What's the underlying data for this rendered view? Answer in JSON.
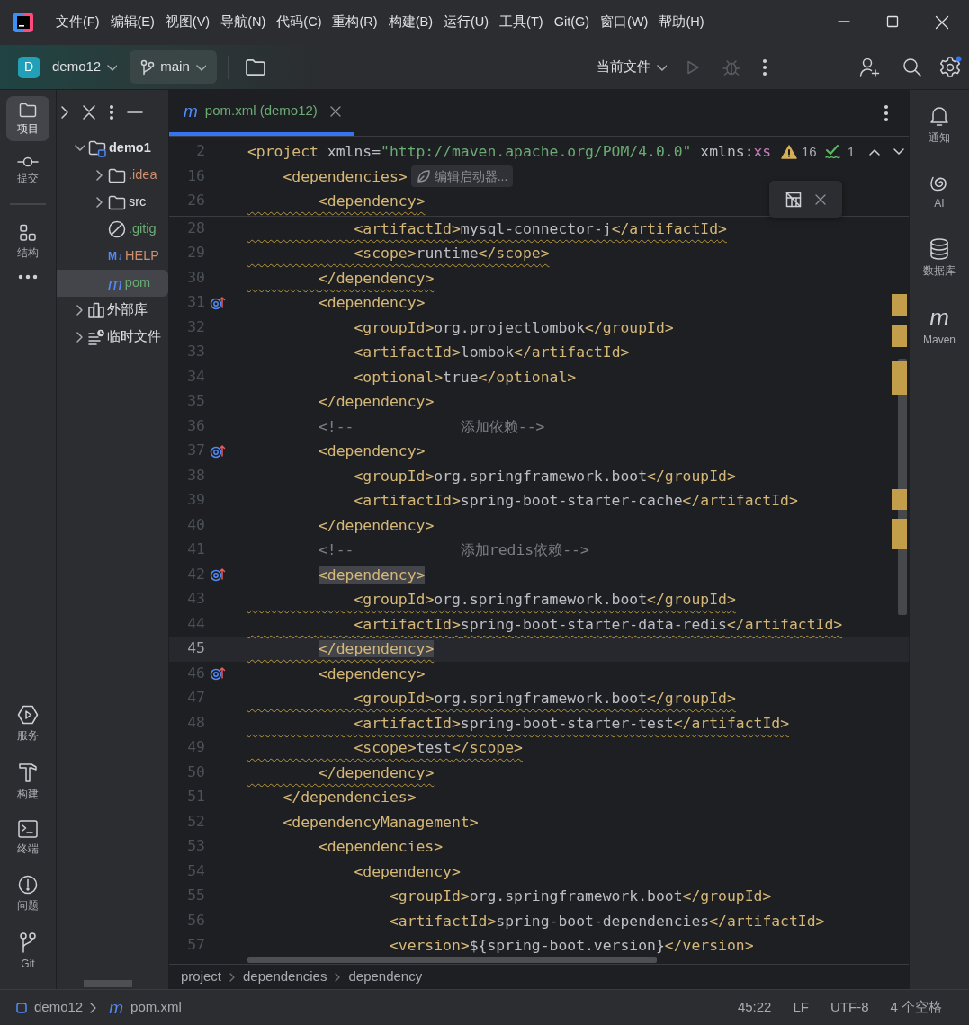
{
  "title_bar": {
    "menu": [
      "文件(F)",
      "编辑(E)",
      "视图(V)",
      "导航(N)",
      "代码(C)",
      "重构(R)",
      "构建(B)",
      "运行(U)",
      "工具(T)",
      "Git(G)",
      "窗口(W)",
      "帮助(H)"
    ]
  },
  "toolbar": {
    "project_badge": "D",
    "project": "demo12",
    "branch": "main",
    "run_config": "当前文件",
    "run_disabled": true,
    "debug_disabled": true,
    "settings_badge": true
  },
  "left_tools": {
    "top": [
      {
        "label": "项目",
        "selected": true
      },
      {
        "label": "提交",
        "selected": false
      },
      {
        "label": "结构",
        "selected": false
      }
    ],
    "bottom": [
      {
        "label": "服务",
        "selected": false
      },
      {
        "label": "构建",
        "selected": false
      },
      {
        "label": "终端",
        "selected": false
      },
      {
        "label": "问题",
        "selected": false
      },
      {
        "label": "Git",
        "selected": false
      }
    ]
  },
  "project_tree": [
    {
      "label": "demo1",
      "kind": "module",
      "expanded": true,
      "selected": false,
      "color": "#dfe1e5",
      "children": [
        {
          "label": ".idea",
          "kind": "folder",
          "expanded": false,
          "selected": false,
          "color": "#cf8e6d"
        },
        {
          "label": "src",
          "kind": "folder",
          "expanded": false,
          "selected": false,
          "color": "#dfe1e5"
        },
        {
          "label": ".gitig",
          "kind": "ignore",
          "selected": false,
          "color": "#6aab73"
        },
        {
          "label": "HELP",
          "kind": "markdown",
          "glyph": "M↓",
          "selected": false,
          "color": "#cf8e6d"
        },
        {
          "label": "pom",
          "kind": "maven",
          "glyph": "m",
          "selected": true,
          "color": "#6aab73"
        }
      ]
    },
    {
      "label": "外部库",
      "kind": "library",
      "expanded": false,
      "selected": false,
      "color": "#dfe1e5"
    },
    {
      "label": "临时文件",
      "kind": "scratch",
      "expanded": false,
      "selected": false,
      "color": "#dfe1e5"
    }
  ],
  "editor": {
    "tabs": [
      {
        "glyph": "m",
        "label": "pom.xml (demo12)",
        "selected": true
      }
    ],
    "problems": {
      "warnings": "16",
      "typos": "1"
    },
    "sticky_lines": [
      {
        "number": "2",
        "kind": "code",
        "text": "<project xmlns=\"http://maven.apache.org/POM/4.0.0\" xmlns:xs",
        "warning": false
      },
      {
        "number": "16",
        "kind": "code",
        "text": "    <dependencies>",
        "warning": false,
        "hint": "编辑启动器..."
      },
      {
        "number": "26",
        "kind": "code",
        "text": "        <dependency>",
        "warning": true
      }
    ],
    "lines": [
      {
        "number": "28",
        "kind": "code",
        "text": "            <artifactId>mysql-connector-j</artifactId>",
        "warning": true,
        "marker": false,
        "current": false,
        "matched": false
      },
      {
        "number": "29",
        "kind": "code",
        "text": "            <scope>runtime</scope>",
        "warning": true,
        "marker": false,
        "current": false,
        "matched": false
      },
      {
        "number": "30",
        "kind": "code",
        "text": "        </dependency>",
        "warning": true,
        "marker": false,
        "current": false,
        "matched": false
      },
      {
        "number": "31",
        "kind": "code",
        "text": "        <dependency>",
        "warning": false,
        "marker": true,
        "current": false,
        "matched": false
      },
      {
        "number": "32",
        "kind": "code",
        "text": "            <groupId>org.projectlombok</groupId>",
        "warning": false,
        "marker": false,
        "current": false,
        "matched": false
      },
      {
        "number": "33",
        "kind": "code",
        "text": "            <artifactId>lombok</artifactId>",
        "warning": false,
        "marker": false,
        "current": false,
        "matched": false
      },
      {
        "number": "34",
        "kind": "code",
        "text": "            <optional>true</optional>",
        "warning": false,
        "marker": false,
        "current": false,
        "matched": false
      },
      {
        "number": "35",
        "kind": "code",
        "text": "        </dependency>",
        "warning": false,
        "marker": false,
        "current": false,
        "matched": false
      },
      {
        "number": "36",
        "kind": "comment",
        "text": "        <!--            添加依赖-->",
        "warning": false,
        "marker": false,
        "current": false,
        "matched": false
      },
      {
        "number": "37",
        "kind": "code",
        "text": "        <dependency>",
        "warning": false,
        "marker": true,
        "current": false,
        "matched": false
      },
      {
        "number": "38",
        "kind": "code",
        "text": "            <groupId>org.springframework.boot</groupId>",
        "warning": false,
        "marker": false,
        "current": false,
        "matched": false
      },
      {
        "number": "39",
        "kind": "code",
        "text": "            <artifactId>spring-boot-starter-cache</artifactId>",
        "warning": false,
        "marker": false,
        "current": false,
        "matched": false
      },
      {
        "number": "40",
        "kind": "code",
        "text": "        </dependency>",
        "warning": false,
        "marker": false,
        "current": false,
        "matched": false
      },
      {
        "number": "41",
        "kind": "comment",
        "text": "        <!--            添加redis依赖-->",
        "warning": false,
        "marker": false,
        "current": false,
        "matched": false
      },
      {
        "number": "42",
        "kind": "code",
        "text": "        <dependency>",
        "warning": false,
        "marker": true,
        "current": false,
        "matched": true
      },
      {
        "number": "43",
        "kind": "code",
        "text": "            <groupId>org.springframework.boot</groupId>",
        "warning": true,
        "marker": false,
        "current": false,
        "matched": false
      },
      {
        "number": "44",
        "kind": "code",
        "text": "            <artifactId>spring-boot-starter-data-redis</artifactId>",
        "warning": true,
        "marker": false,
        "current": false,
        "matched": false
      },
      {
        "number": "45",
        "kind": "code",
        "text": "        </dependency>",
        "warning": true,
        "marker": false,
        "current": true,
        "matched": true
      },
      {
        "number": "46",
        "kind": "code",
        "text": "        <dependency>",
        "warning": false,
        "marker": true,
        "current": false,
        "matched": false
      },
      {
        "number": "47",
        "kind": "code",
        "text": "            <groupId>org.springframework.boot</groupId>",
        "warning": true,
        "marker": false,
        "current": false,
        "matched": false
      },
      {
        "number": "48",
        "kind": "code",
        "text": "            <artifactId>spring-boot-starter-test</artifactId>",
        "warning": true,
        "marker": false,
        "current": false,
        "matched": false
      },
      {
        "number": "49",
        "kind": "code",
        "text": "            <scope>test</scope>",
        "warning": true,
        "marker": false,
        "current": false,
        "matched": false
      },
      {
        "number": "50",
        "kind": "code",
        "text": "        </dependency>",
        "warning": true,
        "marker": false,
        "current": false,
        "matched": false
      },
      {
        "number": "51",
        "kind": "code",
        "text": "    </dependencies>",
        "warning": false,
        "marker": false,
        "current": false,
        "matched": false
      },
      {
        "number": "52",
        "kind": "code",
        "text": "    <dependencyManagement>",
        "warning": false,
        "marker": false,
        "current": false,
        "matched": false
      },
      {
        "number": "53",
        "kind": "code",
        "text": "        <dependencies>",
        "warning": false,
        "marker": false,
        "current": false,
        "matched": false
      },
      {
        "number": "54",
        "kind": "code",
        "text": "            <dependency>",
        "warning": false,
        "marker": false,
        "current": false,
        "matched": false
      },
      {
        "number": "55",
        "kind": "code",
        "text": "                <groupId>org.springframework.boot</groupId>",
        "warning": false,
        "marker": false,
        "current": false,
        "matched": false
      },
      {
        "number": "56",
        "kind": "code",
        "text": "                <artifactId>spring-boot-dependencies</artifactId>",
        "warning": false,
        "marker": false,
        "current": false,
        "matched": false
      },
      {
        "number": "57",
        "kind": "code",
        "text": "                <version>${spring-boot.version}</version>",
        "warning": false,
        "marker": false,
        "current": false,
        "matched": false
      }
    ],
    "breadcrumbs": [
      "project",
      "dependencies",
      "dependency"
    ]
  },
  "right_tools": [
    {
      "label": "通知",
      "selected": false
    },
    {
      "label": "AI",
      "selected": false
    },
    {
      "label": "数据库",
      "selected": false
    },
    {
      "glyph": "m",
      "label": "Maven",
      "selected": false
    }
  ],
  "status_bar": {
    "path": [
      {
        "label": "demo12"
      },
      {
        "glyph": "m",
        "label": "pom.xml"
      }
    ],
    "position": "45:22",
    "line_separator": "LF",
    "encoding": "UTF-8",
    "indent": "4 个空格"
  }
}
